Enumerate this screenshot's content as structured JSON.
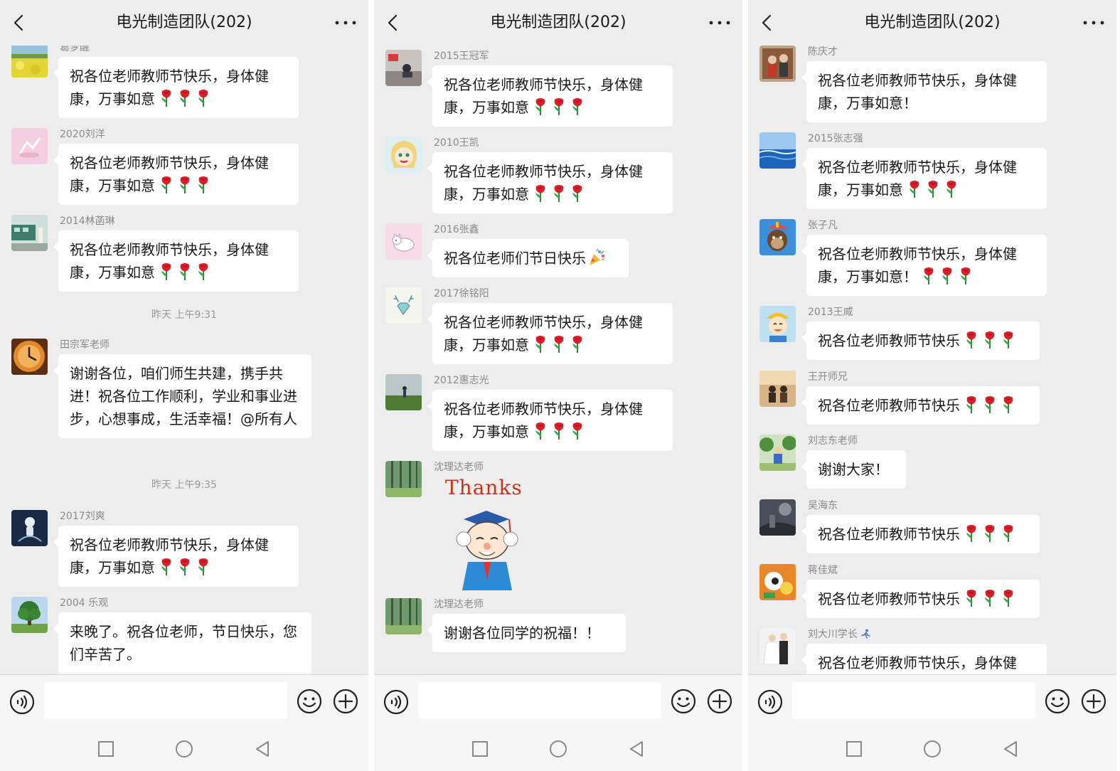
{
  "colors": {
    "panel_bg": "#ededed",
    "bubble_bg": "#ffffff",
    "bar_bg": "#f6f6f6",
    "text": "#191919",
    "sender": "#8a8a8a",
    "rose_red": "#d8202a"
  },
  "panels": [
    {
      "title": "电光制造团队(202)",
      "items": [
        {
          "kind": "msg",
          "sender": "葛梦醒",
          "text": "祝各位老师教师节快乐，身体健康，万事如意",
          "roses": 3,
          "avatar": "avatar-rapeseed-field"
        },
        {
          "kind": "msg",
          "sender": "2020刘洋",
          "text": "祝各位老师教师节快乐，身体健康，万事如意",
          "roses": 3,
          "avatar": "avatar-pink-sketch"
        },
        {
          "kind": "msg",
          "sender": "2014林菡琳",
          "text": "祝各位老师教师节快乐，身体健康，万事如意",
          "roses": 3,
          "avatar": "avatar-train-platform"
        },
        {
          "kind": "time",
          "text": "昨天 上午9:31"
        },
        {
          "kind": "msg",
          "sender": "田宗军老师",
          "text": "谢谢各位，咱们师生共建，携手共进！祝各位工作顺利，学业和事业进步，心想事成，生活幸福！@所有人",
          "roses": 0,
          "avatar": "avatar-clock"
        },
        {
          "kind": "time",
          "text": "昨天 上午9:35"
        },
        {
          "kind": "msg",
          "sender": "2017刘爽",
          "text": "祝各位老师教师节快乐，身体健康，万事如意",
          "roses": 3,
          "avatar": "avatar-astronaut"
        },
        {
          "kind": "msg",
          "sender": "2004 乐观",
          "text": "来晚了。祝各位老师，节日快乐，您们辛苦了。",
          "roses": 0,
          "avatar": "avatar-tree"
        }
      ]
    },
    {
      "title": "电光制造团队(202)",
      "items": [
        {
          "kind": "msg",
          "sender": "2015王冠军",
          "text": "祝各位老师教师节快乐，身体健康，万事如意",
          "roses": 3,
          "avatar": "avatar-street-sit"
        },
        {
          "kind": "msg",
          "sender": "2010王凯",
          "text": "祝各位老师教师节快乐，身体健康，万事如意",
          "roses": 3,
          "avatar": "avatar-anime-girl"
        },
        {
          "kind": "msg",
          "sender": "2016张鑫",
          "text": "祝各位老师们节日快乐",
          "roses": 0,
          "party": true,
          "avatar": "avatar-cat-sketch"
        },
        {
          "kind": "msg",
          "sender": "2017徐铭阳",
          "text": "祝各位老师教师节快乐，身体健康，万事如意",
          "roses": 3,
          "avatar": "avatar-deer-diamond"
        },
        {
          "kind": "msg",
          "sender": "2012惠志光",
          "text": "祝各位老师教师节快乐，身体健康，万事如意",
          "roses": 3,
          "avatar": "avatar-field-person"
        },
        {
          "kind": "sticker",
          "sender": "沈理达老师",
          "sticker_text": "Thanks",
          "avatar": "avatar-forest"
        },
        {
          "kind": "msg",
          "sender": "沈理达老师",
          "text": "谢谢各位同学的祝福！！",
          "roses": 0,
          "avatar": "avatar-forest"
        }
      ]
    },
    {
      "title": "电光制造团队(202)",
      "items": [
        {
          "kind": "msg",
          "sender": "陈庆才",
          "text": "祝各位老师教师节快乐，身体健康，万事如意！",
          "roses": 0,
          "avatar": "avatar-old-photo"
        },
        {
          "kind": "msg",
          "sender": "2015张志强",
          "text": "祝各位老师教师节快乐，身体健康，万事如意",
          "roses": 3,
          "avatar": "avatar-ocean"
        },
        {
          "kind": "msg",
          "sender": "张子凡",
          "text": "祝各位老师教师节快乐，身体健康，万事如意！",
          "roses": 3,
          "avatar": "avatar-ape"
        },
        {
          "kind": "msg",
          "sender": "2013王威",
          "text": "祝各位老师教师节快乐",
          "roses": 3,
          "avatar": "avatar-anime-boy"
        },
        {
          "kind": "msg",
          "sender": "王开师兄",
          "text": "祝各位老师教师节快乐",
          "roses": 3,
          "avatar": "avatar-window-people"
        },
        {
          "kind": "msg",
          "sender": "刘志东老师",
          "text": "谢谢大家！",
          "roses": 0,
          "avatar": "avatar-park-man"
        },
        {
          "kind": "msg",
          "sender": "吴海东",
          "text": "祝各位老师教师节快乐",
          "roses": 3,
          "avatar": "avatar-dark-photo"
        },
        {
          "kind": "msg",
          "sender": "蒋佳斌",
          "text": "祝各位老师教师节快乐",
          "roses": 3,
          "avatar": "avatar-cartoon-orange"
        },
        {
          "kind": "msg",
          "sender": "刘大川学长",
          "runner": true,
          "text": "祝各位老师教师节快乐，身体健康，万事如意",
          "roses": 0,
          "avatar": "avatar-wedding"
        }
      ]
    }
  ],
  "icons": {
    "back": "chevron-left-icon",
    "more": "more-dots-icon",
    "voice": "voice-icon",
    "emoji": "emoji-icon",
    "plus": "plus-icon",
    "nav_square": "nav-square-icon",
    "nav_circle": "nav-circle-icon",
    "nav_back": "nav-triangle-icon"
  }
}
